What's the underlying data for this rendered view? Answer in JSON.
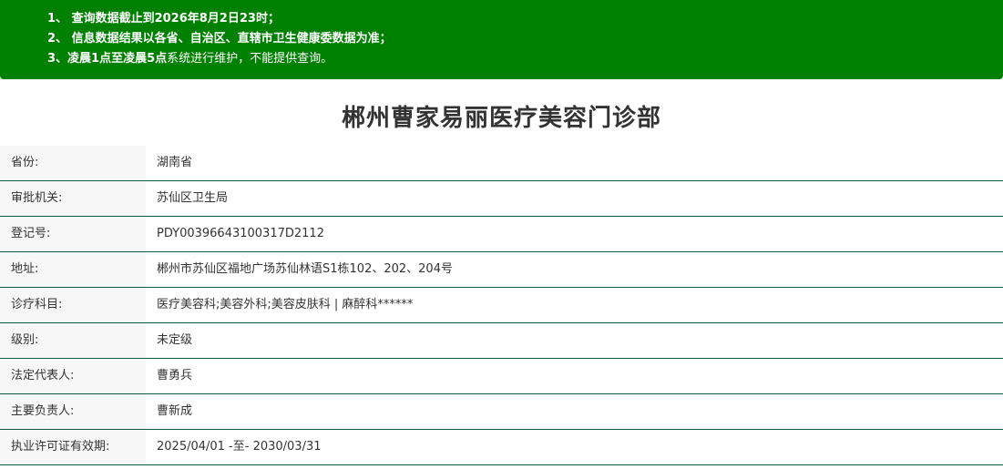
{
  "notice": {
    "line1": {
      "prefix": "1、",
      "text": "查询数据截止到2026年8月2日23时；"
    },
    "line2": {
      "prefix": "2、",
      "text": "信息数据结果以各省、自治区、直辖市卫生健康委数据为准；"
    },
    "line3": {
      "prefix": "3、",
      "bold_text": "凌晨1点至凌晨5点",
      "text": "系统进行维护，不能提供查询。"
    }
  },
  "title": "郴州曹家易丽医疗美容门诊部",
  "rows": [
    {
      "label": "省份:",
      "value": "湖南省"
    },
    {
      "label": "审批机关:",
      "value": "苏仙区卫生局"
    },
    {
      "label": "登记号:",
      "value": "PDY00396643100317D2112"
    },
    {
      "label": "地址:",
      "value": "郴州市苏仙区福地广场苏仙林语S1栋102、202、204号"
    },
    {
      "label": "诊疗科目:",
      "value": "医疗美容科;美容外科;美容皮肤科 | 麻醉科******"
    },
    {
      "label": "级别:",
      "value": "未定级"
    },
    {
      "label": "法定代表人:",
      "value": "曹勇兵"
    },
    {
      "label": "主要负责人:",
      "value": "曹新成"
    },
    {
      "label": "执业许可证有效期:",
      "value": "2025/04/01 -至- 2030/03/31"
    }
  ],
  "colors": {
    "notice_bg": "#008000",
    "row_border": "#0d5b47",
    "label_bg": "#f7f7f7"
  }
}
